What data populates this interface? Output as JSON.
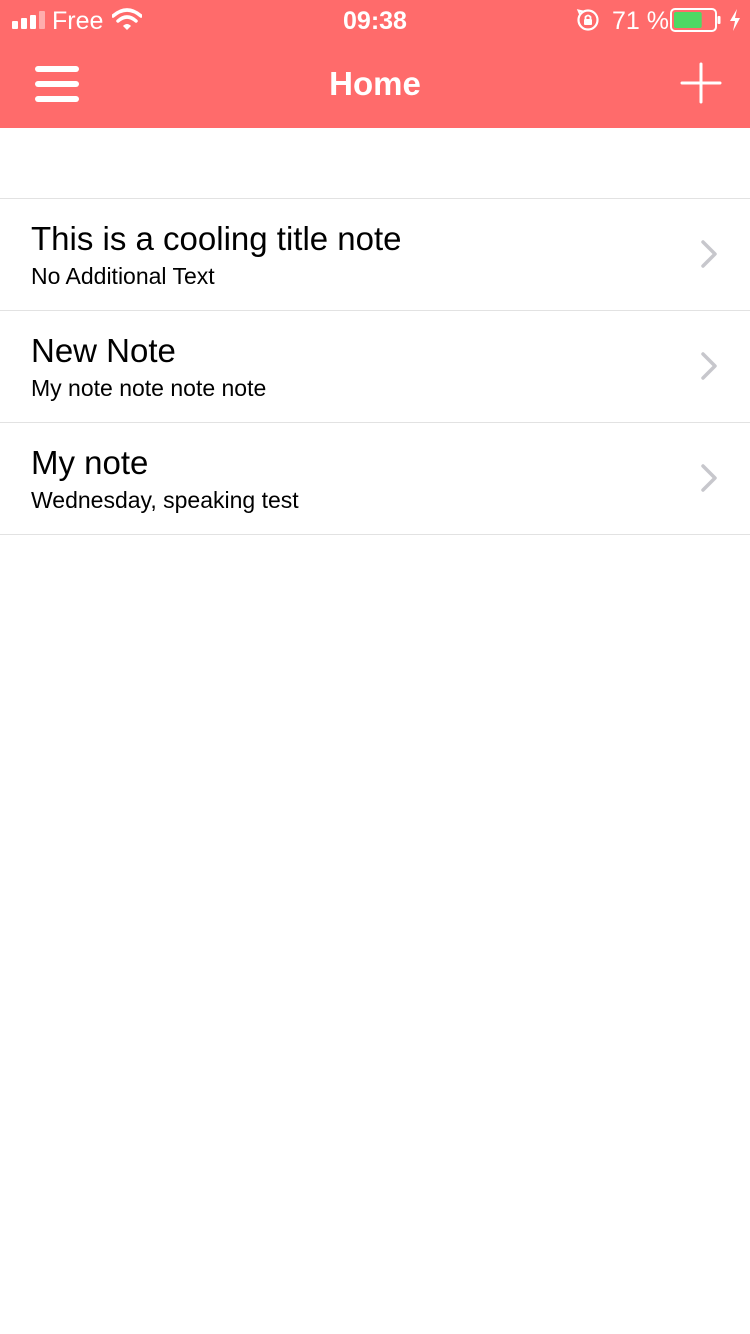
{
  "status_bar": {
    "carrier": "Free",
    "time": "09:38",
    "battery_percent": "71 %",
    "battery_level": 0.71,
    "icons": [
      "signal-icon",
      "wifi-icon",
      "orientation-lock-icon",
      "battery-icon",
      "charging-icon"
    ]
  },
  "nav": {
    "title": "Home",
    "menu_icon": "hamburger-menu-icon",
    "add_icon": "plus-icon"
  },
  "colors": {
    "accent": "#ff6b6b",
    "battery_fill": "#4cd964",
    "separator": "#e2e2e2",
    "chevron": "#c7c7cc"
  },
  "notes": [
    {
      "title": "This is a cooling title note",
      "subtitle": "No Additional Text"
    },
    {
      "title": "New Note",
      "subtitle": "My note note note note"
    },
    {
      "title": "My note",
      "subtitle": "Wednesday, speaking test"
    }
  ]
}
